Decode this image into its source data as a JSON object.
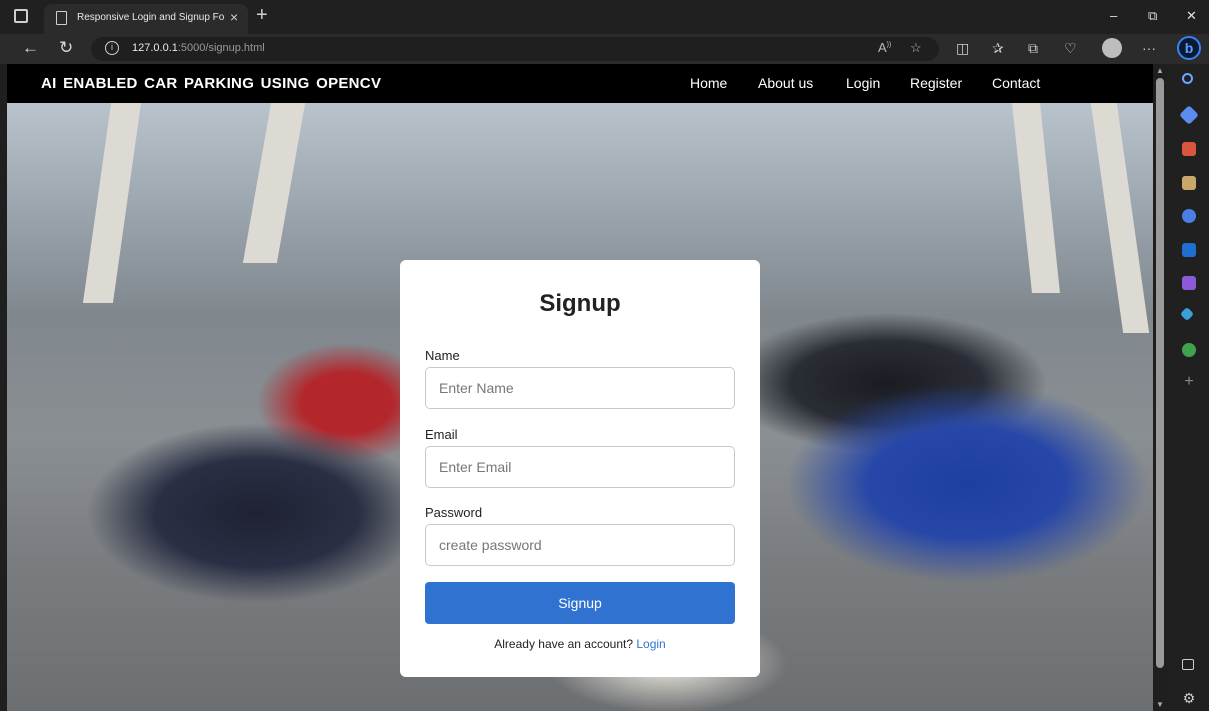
{
  "browser": {
    "tab_title": "Responsive Login and Signup Fo",
    "tab_close": "×",
    "new_tab": "+",
    "url_host": "127.0.0.1",
    "url_path": ":5000/signup.html",
    "window_controls": {
      "minimize": "–",
      "restore": "⧉",
      "close": "✕"
    },
    "icons": [
      "back-icon",
      "refresh-icon",
      "info-icon",
      "read-aloud-icon",
      "favorite-icon",
      "split-screen-icon",
      "favorites-icon",
      "collections-icon",
      "browser-essentials-icon",
      "profile-icon",
      "more-icon",
      "bing-copilot-icon"
    ]
  },
  "navbar": {
    "brand": "AI ENABLED CAR PARKING USING OPENCV",
    "links": [
      "Home",
      "About us",
      "Login",
      "Register",
      "Contact"
    ]
  },
  "signup": {
    "heading": "Signup",
    "name_label": "Name",
    "name_placeholder": "Enter Name",
    "email_label": "Email",
    "email_placeholder": "Enter Email",
    "password_label": "Password",
    "password_placeholder": "create password",
    "submit_label": "Signup",
    "switch_text": "Already have an account?",
    "switch_link": "Login"
  },
  "sidebar": {
    "icons": [
      "search-icon",
      "tag-icon",
      "toolbox-icon",
      "chess-icon",
      "copilot-icon",
      "outlook-icon",
      "drop-icon",
      "telegram-icon",
      "tree-icon",
      "add-icon",
      "sidebar-toggle-icon",
      "settings-icon"
    ]
  },
  "colors": {
    "accent": "#2f72d0",
    "navbar": "#000000",
    "chrome": "#202020"
  }
}
